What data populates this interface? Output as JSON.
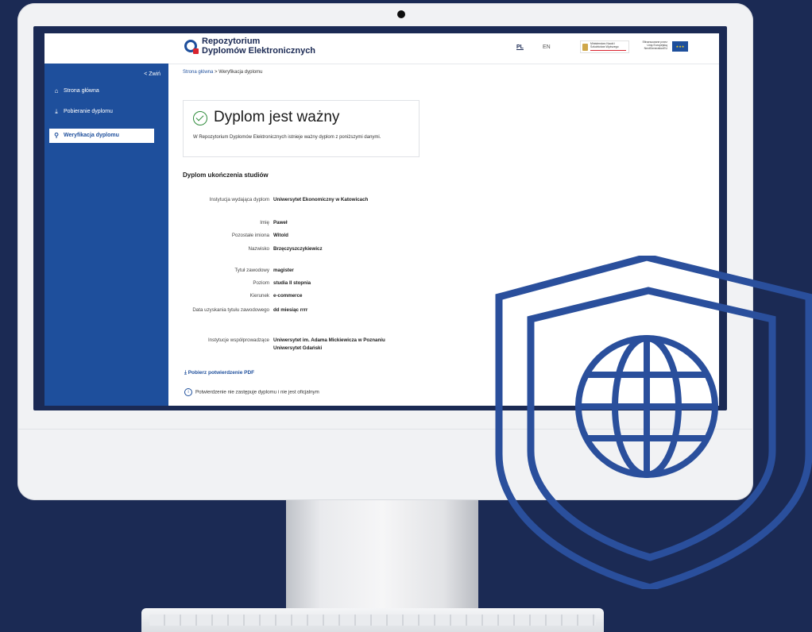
{
  "header": {
    "logo_line1": "Repozytorium",
    "logo_line2": "Dyplomów Elektronicznych",
    "lang_pl": "PL",
    "lang_en": "EN",
    "ministry_text": "Ministerstwo Nauki i Szkolnictwa Wyższego",
    "funding_text": "Sfinansowane przez Unię Europejską NextGenerationEU"
  },
  "sidebar": {
    "collapse_label": "< Zwiń",
    "items": [
      {
        "label": "Strona główna",
        "icon": "home-icon"
      },
      {
        "label": "Pobieranie dyplomu",
        "icon": "download-icon"
      },
      {
        "label": "Weryfikacja dyplomu",
        "icon": "search-icon",
        "active": true
      }
    ]
  },
  "breadcrumb": {
    "home": "Strona główna",
    "separator": ">",
    "current": "Weryfikacja dyplomu"
  },
  "status": {
    "title": "Dyplom jest ważny",
    "description": "W Repozytorium Dyplomów Elektronicznych istnieje ważny dyplom z poniższymi danymi."
  },
  "section_title": "Dyplom ukończenia studiów",
  "fields": [
    {
      "label": "Instytucja wydająca dyplom",
      "value": "Uniwersytet Ekonomiczny w Katowicach"
    },
    {
      "label": "Imię",
      "value": "Paweł"
    },
    {
      "label": "Pozostałe imiona",
      "value": "Witold"
    },
    {
      "label": "Nazwisko",
      "value": "Brzęczyszczykiewicz"
    },
    {
      "label": "Tytuł zawodowy",
      "value": "magister"
    },
    {
      "label": "Poziom",
      "value": "studia II stopnia"
    },
    {
      "label": "Kierunek",
      "value": "e-commerce"
    },
    {
      "label": "Data uzyskania tytułu zawodowego",
      "value": "dd miesiąc rrrr"
    },
    {
      "label": "Instytucje współprowadzące",
      "value": "Uniwersytet im. Adama Mickiewicza w Poznaniu",
      "value2": "Uniwersytet Gdański"
    }
  ],
  "download_label": "Pobierz potwierdzenie PDF",
  "notice": "Potwierdzenie nie zastępuje dyplomu i nie jest oficjalnym",
  "colors": {
    "background": "#1b2a54",
    "brand_blue": "#1e4f9c",
    "shield_stroke": "#2a4f9c"
  }
}
